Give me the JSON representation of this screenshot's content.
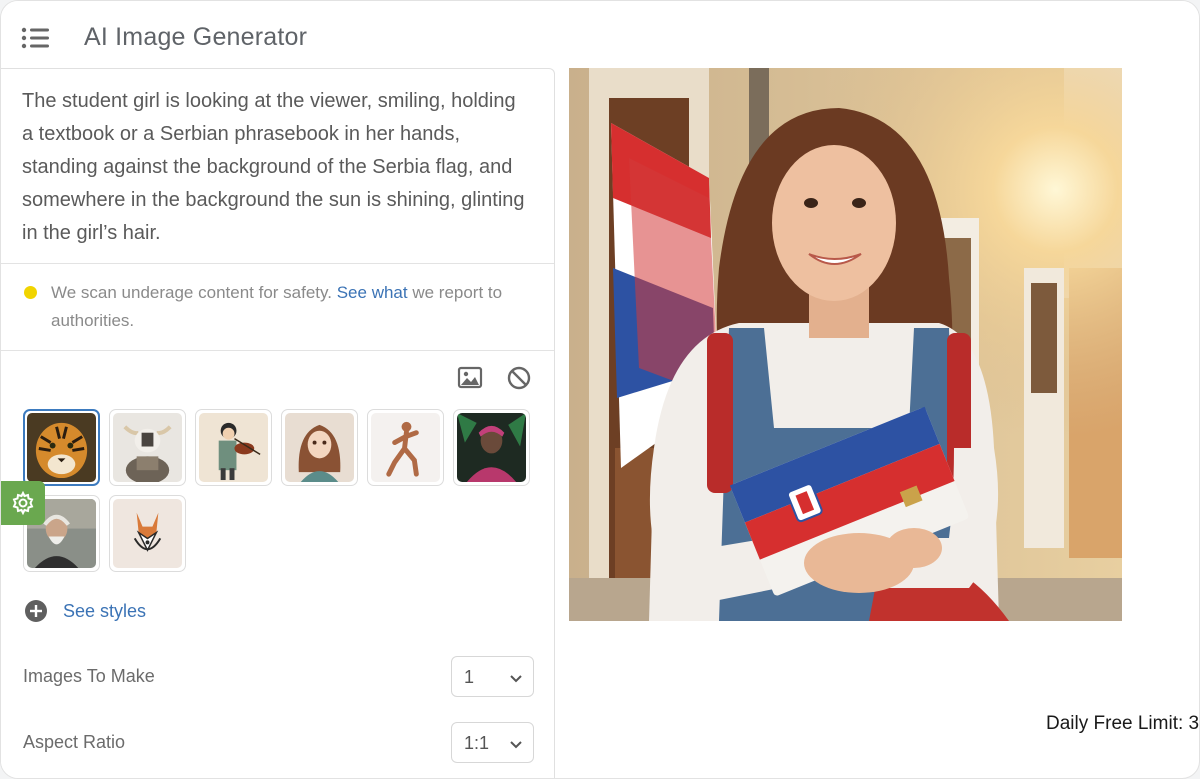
{
  "app": {
    "title": "AI Image Generator"
  },
  "prompt": {
    "text": "The student girl is looking at the viewer, smiling, holding a textbook or a Serbian phrasebook in her hands, standing against the background of the Serbia flag, and somewhere in the background the sun is shining, glinting in the girl’s hair."
  },
  "notice": {
    "before": "We scan underage content for safety. ",
    "link": "See what",
    "after": " we report to authorities.",
    "dot_color": "#f1d400"
  },
  "tools": {
    "image_icon": "image-icon",
    "clear_icon": "prohibit-icon"
  },
  "styles": {
    "items": [
      {
        "name": "tiger",
        "selected": true
      },
      {
        "name": "robot-bull",
        "selected": false
      },
      {
        "name": "violinist",
        "selected": false
      },
      {
        "name": "anime-girl",
        "selected": false
      },
      {
        "name": "bronze-runner",
        "selected": false
      },
      {
        "name": "neon-warrior",
        "selected": false
      },
      {
        "name": "old-man",
        "selected": false
      },
      {
        "name": "dog-logo",
        "selected": false
      }
    ],
    "see_styles_label": "See styles"
  },
  "settings": {
    "images_to_make": {
      "label": "Images To Make",
      "value": "1"
    },
    "aspect_ratio": {
      "label": "Aspect Ratio",
      "value": "1:1"
    }
  },
  "footer": {
    "daily_limit": "Daily Free Limit: 3"
  },
  "colors": {
    "accent": "#3b73b5",
    "settings_tab": "#6aa84f"
  }
}
